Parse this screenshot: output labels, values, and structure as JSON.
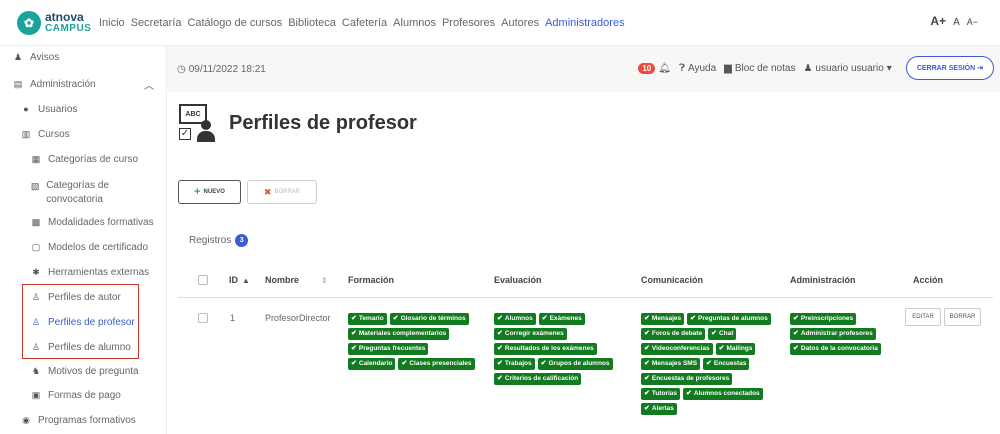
{
  "brand": {
    "name": "atnova",
    "sub": "CAMPUS"
  },
  "nav": [
    {
      "label": "Inicio",
      "active": false
    },
    {
      "label": "Secretaría",
      "active": false
    },
    {
      "label": "Catálogo de cursos",
      "active": false
    },
    {
      "label": "Biblioteca",
      "active": false
    },
    {
      "label": "Cafetería",
      "active": false
    },
    {
      "label": "Alumnos",
      "active": false
    },
    {
      "label": "Profesores",
      "active": false
    },
    {
      "label": "Autores",
      "active": false
    },
    {
      "label": "Administradores",
      "active": true
    }
  ],
  "font_size": {
    "large": "A+",
    "medium": "A",
    "small": "A−"
  },
  "sidebar": {
    "items": [
      {
        "label": "Avisos",
        "icon": "bell-icon"
      },
      {
        "label": "Administración",
        "icon": "book-icon"
      },
      {
        "label": "Usuarios",
        "icon": "user-icon"
      },
      {
        "label": "Cursos",
        "icon": "book-icon"
      },
      {
        "label": "Categorías de curso",
        "icon": "category-icon"
      },
      {
        "label": "Categorías de convocatoria",
        "icon": "category-icon"
      },
      {
        "label": "Modalidades formativas",
        "icon": "modality-icon"
      },
      {
        "label": "Modelos de certificado",
        "icon": "certificate-icon"
      },
      {
        "label": "Herramientas externas",
        "icon": "tools-icon"
      },
      {
        "label": "Perfiles de autor",
        "icon": "profile-icon"
      },
      {
        "label": "Perfiles de profesor",
        "icon": "profile-icon",
        "active": true
      },
      {
        "label": "Perfiles de alumno",
        "icon": "profile-icon"
      },
      {
        "label": "Motivos de pregunta",
        "icon": "question-icon"
      },
      {
        "label": "Formas de pago",
        "icon": "payment-icon"
      },
      {
        "label": "Programas formativos",
        "icon": "program-icon"
      }
    ]
  },
  "subheader": {
    "datetime": "09/11/2022 18:21",
    "notifications": "10",
    "help": "Ayuda",
    "notes": "Bloc de notas",
    "user": "usuario usuario",
    "logout": "CERRAR SESIÓN"
  },
  "page": {
    "title": "Perfiles de profesor",
    "icon_text": "ABC",
    "new_button": "NUEVO",
    "delete_button": "BORRAR",
    "records_label": "Registros",
    "records_count": "3"
  },
  "table": {
    "headers": {
      "id": "ID",
      "name": "Nombre",
      "formacion": "Formación",
      "evaluacion": "Evaluación",
      "comunicacion": "Comunicación",
      "administracion": "Administración",
      "accion": "Acción"
    },
    "row": {
      "id": "1",
      "name": "ProfesorDirector",
      "formacion": [
        "Temario",
        "Glosario de términos",
        "Materiales complementarios",
        "Preguntas frecuentes",
        "Calendario",
        "Clases presenciales"
      ],
      "evaluacion": [
        "Alumnos",
        "Exámenes",
        "Corregir exámenes",
        "Resultados de los exámenes",
        "Trabajos",
        "Grupos de alumnos",
        "Criterios de calificación"
      ],
      "comunicacion": [
        "Mensajes",
        "Preguntas de alumnos",
        "Foros de debate",
        "Chat",
        "Videoconferencias",
        "Mailings",
        "Mensajes SMS",
        "Encuestas",
        "Encuestas de profesores",
        "Tutorías",
        "Alumnos conectados",
        "Alertas"
      ],
      "administracion": [
        "Preinscripciones",
        "Administrar profesores",
        "Datos de la convocatoria"
      ],
      "edit": "EDITAR",
      "delete": "BORRAR"
    }
  }
}
